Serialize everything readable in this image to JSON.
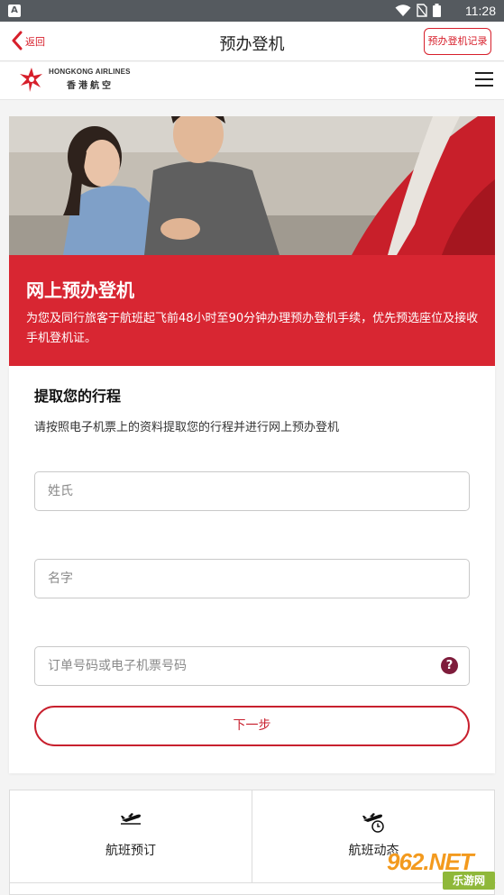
{
  "status_bar": {
    "app_badge": "A",
    "time": "11:28"
  },
  "nav": {
    "back_label": "返回",
    "title": "预办登机",
    "records_label": "预办登机记录"
  },
  "brand": {
    "name_en": "HONGKONG AIRLINES",
    "name_zh": "香港航空"
  },
  "hero": {
    "title": "网上预办登机",
    "description": "为您及同行旅客于航班起飞前48小时至90分钟办理预办登机手续，优先预选座位及接收手机登机证。"
  },
  "form": {
    "heading": "提取您的行程",
    "subheading": "请按照电子机票上的资料提取您的行程并进行网上预办登机",
    "surname_placeholder": "姓氏",
    "given_name_placeholder": "名字",
    "booking_ref_placeholder": "订单号码或电子机票号码",
    "help_glyph": "?",
    "next_label": "下一步"
  },
  "tiles": [
    {
      "label": "航班预订",
      "icon": "plane-takeoff-icon"
    },
    {
      "label": "航班动态",
      "icon": "plane-clock-icon"
    }
  ],
  "watermark": {
    "main": "962.NET",
    "sub": "乐游网"
  },
  "colors": {
    "brand_red": "#d82632",
    "help_icon": "#7e1c3b",
    "status_bar": "#555a5f"
  }
}
